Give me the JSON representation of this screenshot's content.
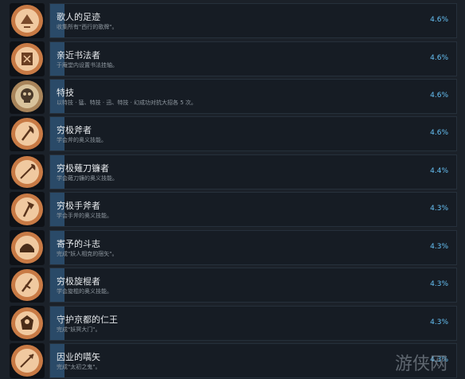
{
  "achievements": [
    {
      "title": "歌人的足迹",
      "desc": "收集所有\"西行的歌牌\"。",
      "percent": "4.6%",
      "percent_value": 4.6,
      "icon": "songbook-icon"
    },
    {
      "title": "亲近书法者",
      "desc": "于庵堂内设置书法挂轴。",
      "percent": "4.6%",
      "percent_value": 4.6,
      "icon": "calligraphy-scroll-icon"
    },
    {
      "title": "特技",
      "desc": "以特技 · 猛、特技 · 迅、特技 · 幻成功对抗大招各 5 次。",
      "percent": "4.6%",
      "percent_value": 4.6,
      "icon": "skull-icon"
    },
    {
      "title": "穷极斧者",
      "desc": "学会斧的奥义技能。",
      "percent": "4.6%",
      "percent_value": 4.6,
      "icon": "axe-icon"
    },
    {
      "title": "穷极薙刀镰者",
      "desc": "学会薙刀镰的奥义技能。",
      "percent": "4.4%",
      "percent_value": 4.4,
      "icon": "naginata-icon"
    },
    {
      "title": "穷极手斧者",
      "desc": "学会手斧的奥义技能。",
      "percent": "4.3%",
      "percent_value": 4.3,
      "icon": "hand-axe-icon"
    },
    {
      "title": "寄予的斗志",
      "desc": "完成\"妖人相克的宿矢\"。",
      "percent": "4.3%",
      "percent_value": 4.3,
      "icon": "helmet-icon"
    },
    {
      "title": "穷极旋棍者",
      "desc": "学会旋棍的奥义技能。",
      "percent": "4.3%",
      "percent_value": 4.3,
      "icon": "tonfa-icon"
    },
    {
      "title": "守护京都的仁王",
      "desc": "完成\"妖冥大门\"。",
      "percent": "4.3%",
      "percent_value": 4.3,
      "icon": "guardian-icon"
    },
    {
      "title": "因业的嚆矢",
      "desc": "完成\"太初之鬼\"。",
      "percent": "4.3%",
      "percent_value": 4.3,
      "icon": "arrow-icon"
    }
  ],
  "watermark": {
    "text": "游侠网",
    "color": "#9aa4ad"
  },
  "colors": {
    "background": "#1b2129",
    "bar": "#161c24",
    "fill": "#2a4a68",
    "percent_text": "#66c0f4",
    "title_text": "#e6e9ec",
    "desc_text": "#8f98a0",
    "icon_orange": "#d98a4a"
  }
}
